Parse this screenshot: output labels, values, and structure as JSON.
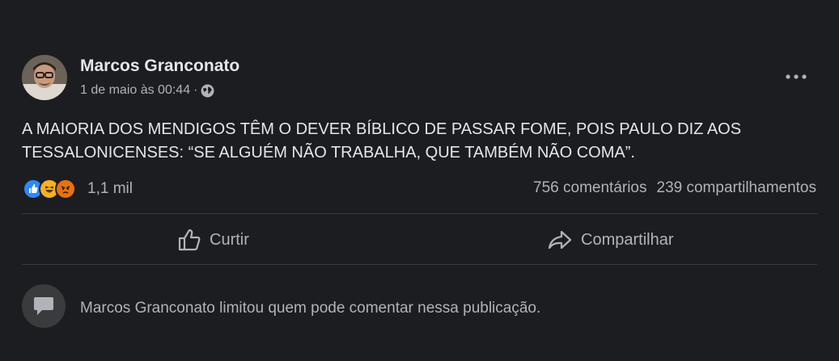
{
  "post": {
    "author": "Marcos Granconato",
    "timestamp": "1 de maio às 00:44",
    "separator": "·",
    "audience_icon": "globe-icon",
    "more_icon": "more-options-icon",
    "text_line1": "A MAIORIA DOS MENDIGOS TÊM O DEVER BÍBLICO DE PASSAR FOME, POIS PAULO DIZ AOS",
    "text_line2": "TESSALONICENSES: “SE ALGUÉM NÃO TRABALHA, QUE TAMBÉM NÃO COMA”."
  },
  "reactions": {
    "icons": [
      "like-icon",
      "haha-icon",
      "angry-icon"
    ],
    "count": "1,1 mil",
    "colors": {
      "like": "#2d88ff",
      "haha": "#f7b125",
      "angry": "#e9710f"
    }
  },
  "stats": {
    "comments": "756 comentários",
    "shares": "239 compartilhamentos"
  },
  "actions": {
    "like_label": "Curtir",
    "share_label": "Compartilhar"
  },
  "notice": {
    "text": "Marcos Granconato limitou quem pode comentar nessa publicação."
  }
}
